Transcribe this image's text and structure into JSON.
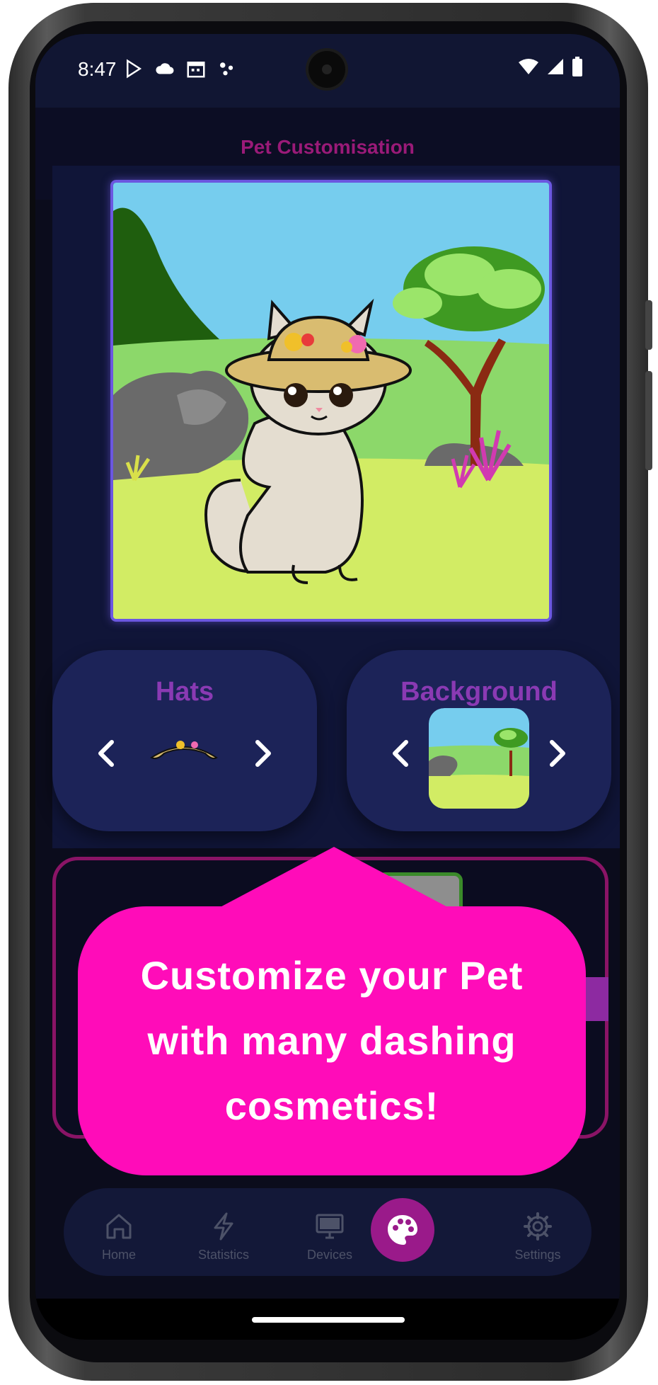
{
  "status_bar": {
    "time": "8:47",
    "left_icons": [
      "play-store-icon",
      "cloud-icon",
      "calendar-icon",
      "dots-icon"
    ],
    "right_icons": [
      "wifi-icon",
      "signal-icon",
      "battery-icon"
    ]
  },
  "header": {
    "title": "Pet Customisation"
  },
  "pet_preview": {
    "description_icon": "cat-with-hat-illustration"
  },
  "hats_card": {
    "title": "Hats",
    "selected_icon": "straw-hat-icon"
  },
  "background_card": {
    "title": "Background",
    "selected_icon": "meadow-background-thumbnail"
  },
  "bubble": {
    "text": "Customize your Pet with many dashing cosmetics!"
  },
  "nav": {
    "items": [
      {
        "label": "Home",
        "icon": "home-icon"
      },
      {
        "label": "Statistics",
        "icon": "lightning-icon"
      },
      {
        "label": "Devices",
        "icon": "monitor-icon"
      },
      {
        "label": "",
        "icon": "palette-icon"
      },
      {
        "label": "Settings",
        "icon": "gear-icon"
      }
    ],
    "active_index": 3
  },
  "colors": {
    "accent_magenta": "#ff0cb9",
    "title_color": "#9a1a78",
    "card_title": "#8a3ab3",
    "card_bg": "#1c2358",
    "frame_border": "#6b57e0"
  }
}
